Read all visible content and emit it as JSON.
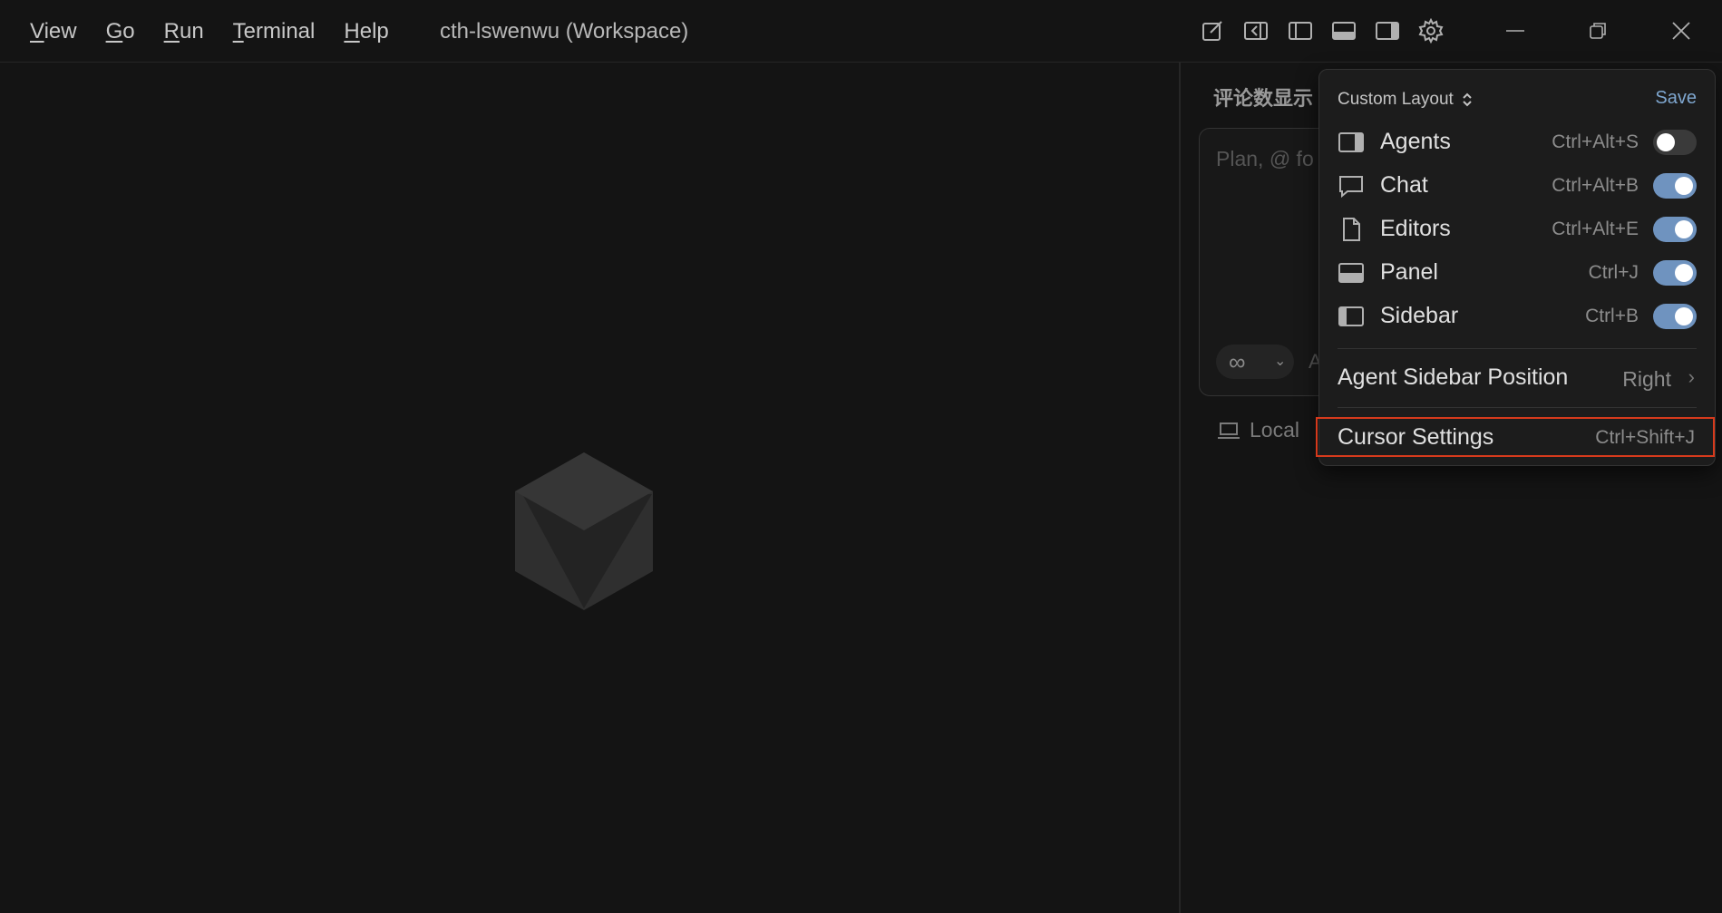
{
  "menu": [
    {
      "first": "V",
      "rest": "iew"
    },
    {
      "first": "G",
      "rest": "o"
    },
    {
      "first": "R",
      "rest": "un"
    },
    {
      "first": "T",
      "rest": "erminal"
    },
    {
      "first": "H",
      "rest": "elp"
    }
  ],
  "workspace_title": "cth-lswenwu (Workspace)",
  "toolbar_icons": [
    "new-file-icon",
    "toggle-agents-icon",
    "toggle-sidebar-icon",
    "toggle-panel-icon",
    "toggle-secondary-sidebar-icon",
    "gear-icon"
  ],
  "window_controls": [
    "minimize-icon",
    "restore-icon",
    "close-icon"
  ],
  "chat": {
    "title": "评论数显示",
    "placeholder": "Plan, @ fo",
    "mode_icon": "∞",
    "mode_extra": "A",
    "local_label": "Local"
  },
  "dropdown": {
    "header": "Custom Layout",
    "save": "Save",
    "items": [
      {
        "label": "Agents",
        "shortcut": "Ctrl+Alt+S",
        "on": false,
        "icon": "agents-icon"
      },
      {
        "label": "Chat",
        "shortcut": "Ctrl+Alt+B",
        "on": true,
        "icon": "chat-bubble-icon"
      },
      {
        "label": "Editors",
        "shortcut": "Ctrl+Alt+E",
        "on": true,
        "icon": "file-icon"
      },
      {
        "label": "Panel",
        "shortcut": "Ctrl+J",
        "on": true,
        "icon": "panel-icon"
      },
      {
        "label": "Sidebar",
        "shortcut": "Ctrl+B",
        "on": true,
        "icon": "sidebar-icon"
      }
    ],
    "position_label": "Agent Sidebar Position",
    "position_value": "Right",
    "settings_label": "Cursor Settings",
    "settings_shortcut": "Ctrl+Shift+J"
  },
  "colors": {
    "background": "#141414",
    "accent_toggle": "#6f93bf",
    "highlight_border": "#d63a1c",
    "save_link": "#7fa7d0"
  }
}
